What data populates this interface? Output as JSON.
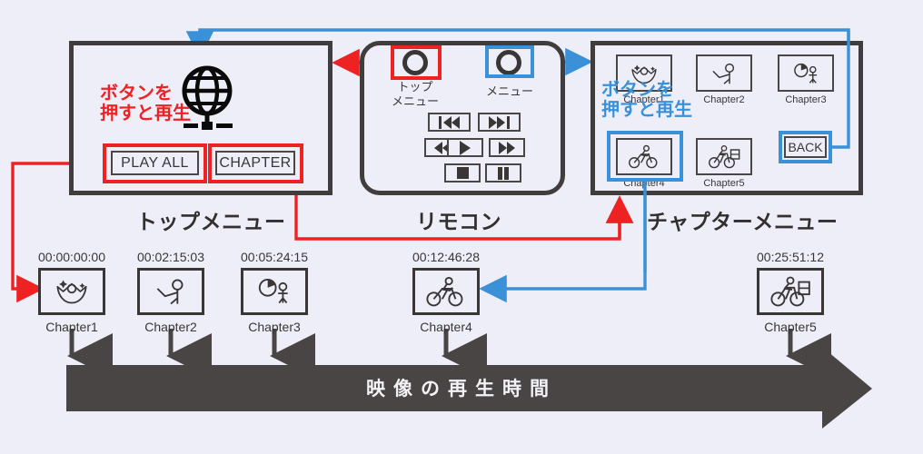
{
  "background_color": "#eeeef8",
  "colors": {
    "ink": "#413d3d",
    "red": "#ee2222",
    "blue": "#3a91d8",
    "bar": "#4a4545"
  },
  "top_menu": {
    "label": "トップメニュー",
    "annotation": "ボタンを\n押すと再生",
    "annotation_line1": "ボタンを",
    "annotation_line2": "押すと再生",
    "globe_icon": "globe-on-stand-icon",
    "buttons": [
      {
        "id": "play-all",
        "label": "PLAY ALL",
        "highlight": "red"
      },
      {
        "id": "chapter",
        "label": "CHAPTER",
        "highlight": "red"
      }
    ]
  },
  "remote": {
    "label": "リモコン",
    "knobs": [
      {
        "id": "top-menu-knob",
        "label_line1": "トップ",
        "label_line2": "メニュー",
        "highlight": "red"
      },
      {
        "id": "menu-knob",
        "label_line1": "メニュー",
        "label_line2": "",
        "highlight": "blue"
      }
    ],
    "transport": [
      {
        "id": "prev-track",
        "icon": "skip-back-icon"
      },
      {
        "id": "next-track",
        "icon": "skip-forward-icon"
      },
      {
        "id": "rewind",
        "icon": "rewind-icon"
      },
      {
        "id": "play",
        "icon": "play-icon"
      },
      {
        "id": "fast-forward",
        "icon": "fast-forward-icon"
      },
      {
        "id": "stop",
        "icon": "stop-icon"
      },
      {
        "id": "pause",
        "icon": "pause-icon"
      }
    ]
  },
  "chapter_menu": {
    "label": "チャプターメニュー",
    "annotation_line1": "ボタンを",
    "annotation_line2": "押すと再生",
    "thumbs": [
      {
        "id": "chapter1",
        "caption": "Chapter1",
        "icon": "celebrate-icon",
        "highlight": ""
      },
      {
        "id": "chapter2",
        "caption": "Chapter2",
        "icon": "presenter-icon",
        "highlight": ""
      },
      {
        "id": "chapter3",
        "caption": "Chapter3",
        "icon": "pie-chart-presenter-icon",
        "highlight": ""
      },
      {
        "id": "chapter4",
        "caption": "Chapter4",
        "icon": "cyclist-icon",
        "highlight": "blue"
      },
      {
        "id": "chapter5",
        "caption": "Chapter5",
        "icon": "delivery-cyclist-icon",
        "highlight": ""
      }
    ],
    "back_button": {
      "label": "BACK",
      "highlight": "blue"
    }
  },
  "timeline": {
    "bar_label": "映像の再生時間",
    "chapters": [
      {
        "timecode": "00:00:00:00",
        "caption": "Chapter1",
        "icon": "celebrate-icon"
      },
      {
        "timecode": "00:02:15:03",
        "caption": "Chapter2",
        "icon": "presenter-icon"
      },
      {
        "timecode": "00:05:24:15",
        "caption": "Chapter3",
        "icon": "pie-chart-presenter-icon"
      },
      {
        "timecode": "00:12:46:28",
        "caption": "Chapter4",
        "icon": "cyclist-icon"
      },
      {
        "timecode": "00:25:51:12",
        "caption": "Chapter5",
        "icon": "delivery-cyclist-icon"
      }
    ]
  }
}
